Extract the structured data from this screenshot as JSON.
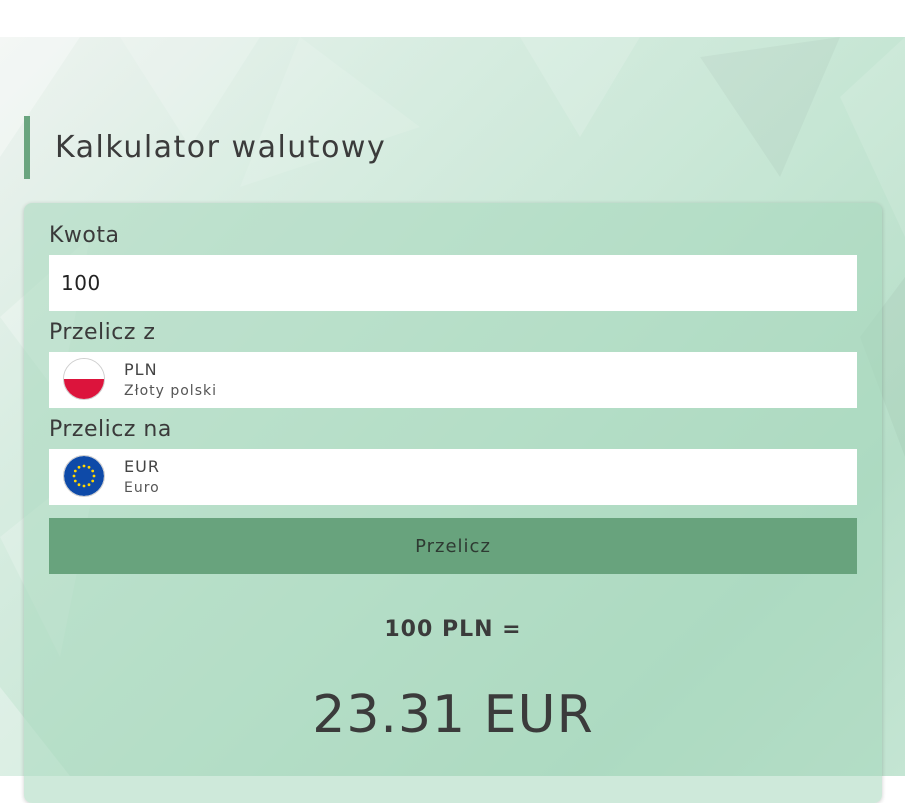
{
  "calculator": {
    "title": "Kalkulator walutowy",
    "amount_label": "Kwota",
    "amount_value": "100",
    "from_label": "Przelicz z",
    "from_currency": {
      "code": "PLN",
      "name": "Złoty polski",
      "flag_icon": "poland-flag-icon"
    },
    "to_label": "Przelicz na",
    "to_currency": {
      "code": "EUR",
      "name": "Euro",
      "flag_icon": "eu-flag-icon"
    },
    "convert_button": "Przelicz",
    "result_line": "100 PLN =",
    "result_value": "23.31 EUR"
  },
  "colors": {
    "accent": "#6aa57f",
    "button": "#68a37d"
  }
}
